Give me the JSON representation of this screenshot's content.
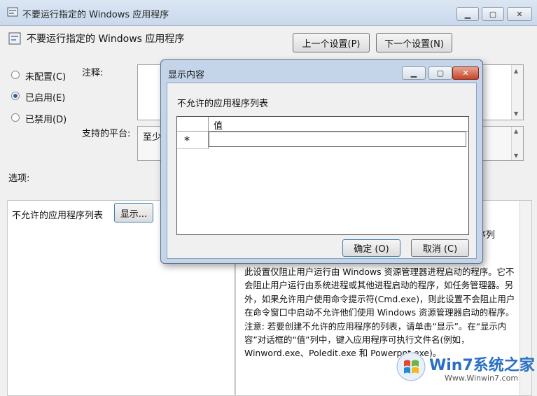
{
  "window": {
    "title": "不要运行指定的 Windows 应用程序",
    "heading": "不要运行指定的 Windows 应用程序",
    "prev_button": "上一个设置(P)",
    "next_button": "下一个设置(N)"
  },
  "options": {
    "not_configured": "未配置(C)",
    "enabled": "已启用(E)",
    "disabled": "已禁用(D)",
    "selected": "enabled"
  },
  "labels": {
    "comment": "注释:",
    "supported": "支持的平台:",
    "supported_value": "至少",
    "options": "选项:"
  },
  "options_panel": {
    "list_label": "不允许的应用程序列表",
    "show_button": "显示..."
  },
  "help_text": {
    "fragment": "序列",
    "body": "此设置仅阻止用户运行由 Windows 资源管理器进程启动的程序。它不会阻止用户运行由系统进程或其他进程启动的程序，如任务管理器。另外，如果允许用户使用命令提示符(Cmd.exe)，则此设置不会阻止用户在命令窗口中启动不允许他们使用 Windows 资源管理器启动的程序。注意: 若要创建不允许的应用程序的列表，请单击“显示”。在“显示内容”对话框的“值”列中，键入应用程序可执行文件名(例如，Winword.exe、Poledit.exe 和 Powerpnt.exe)。"
  },
  "dialog": {
    "title": "显示内容",
    "heading": "不允许的应用程序列表",
    "column_header": "值",
    "row_marker": "*",
    "ok_button": "确定 (O)",
    "cancel_button": "取消 (C)"
  },
  "watermark": {
    "brand": "Win7系统之家",
    "url": "Www.Winwin7.com"
  }
}
